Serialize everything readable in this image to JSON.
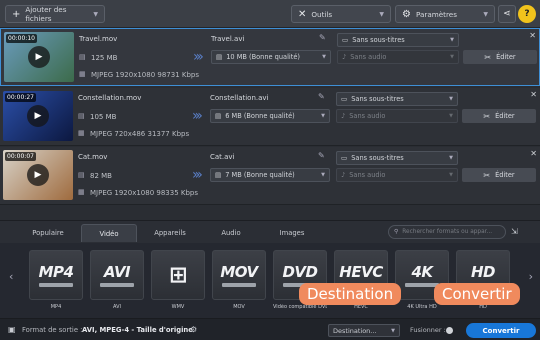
{
  "toolbar": {
    "add_files_label": "Ajouter des fichiers",
    "tools_label": "Outils",
    "settings_label": "Paramètres"
  },
  "files": [
    {
      "duration": "00:00:10",
      "name": "Travel.mov",
      "size": "125 MB",
      "meta": "MJPEG 1920x1080 98731 Kbps",
      "output_name": "Travel.avi",
      "output_quality": "10 MB (Bonne qualité)",
      "subtitles": "Sans sous-titres",
      "audio": "Sans audio",
      "edit_label": "Éditer",
      "selected": true,
      "thumb_colors": [
        "#6a9bbd",
        "#3c6b4a"
      ]
    },
    {
      "duration": "00:00:27",
      "name": "Constellation.mov",
      "size": "105 MB",
      "meta": "MJPEG 720x486 31377 Kbps",
      "output_name": "Constellation.avi",
      "output_quality": "6 MB (Bonne qualité)",
      "subtitles": "Sans sous-titres",
      "audio": "Sans audio",
      "edit_label": "Éditer",
      "selected": false,
      "thumb_colors": [
        "#2b4fa8",
        "#0c1840"
      ]
    },
    {
      "duration": "00:00:07",
      "name": "Cat.mov",
      "size": "82 MB",
      "meta": "MJPEG 1920x1080 98335 Kbps",
      "output_name": "Cat.avi",
      "output_quality": "7 MB (Bonne qualité)",
      "subtitles": "Sans sous-titres",
      "audio": "Sans audio",
      "edit_label": "Éditer",
      "selected": false,
      "thumb_colors": [
        "#d7d2c8",
        "#9f6b3e"
      ]
    }
  ],
  "tabs": [
    "Populaire",
    "Vidéo",
    "Appareils",
    "Audio",
    "Images"
  ],
  "active_tab": "Vidéo",
  "format_search_placeholder": "Rechercher formats ou appar...",
  "formats": [
    {
      "logo": "MP4",
      "caption": "MP4"
    },
    {
      "logo": "AVI",
      "caption": "AVI"
    },
    {
      "logo": "WIN",
      "caption": "WMV"
    },
    {
      "logo": "MOV",
      "caption": "MOV"
    },
    {
      "logo": "DVD",
      "caption": "Vidéo compatible DVD"
    },
    {
      "logo": "HEVC",
      "caption": "HEVC"
    },
    {
      "logo": "4K",
      "caption": "4K Ultra HD"
    },
    {
      "logo": "HD",
      "caption": "HD"
    }
  ],
  "callouts": {
    "destination": "Destination",
    "convert": "Convertir"
  },
  "footer": {
    "output_format_label": "Format de sortie :",
    "output_format_value": "AVI, MPEG-4 - Taille d'origine",
    "destination_label": "Destination...",
    "merge_label": "Fusionner :",
    "convert_label": "Convertir"
  },
  "accent_color": "#1877d8",
  "callout_color": "#f08a5d"
}
